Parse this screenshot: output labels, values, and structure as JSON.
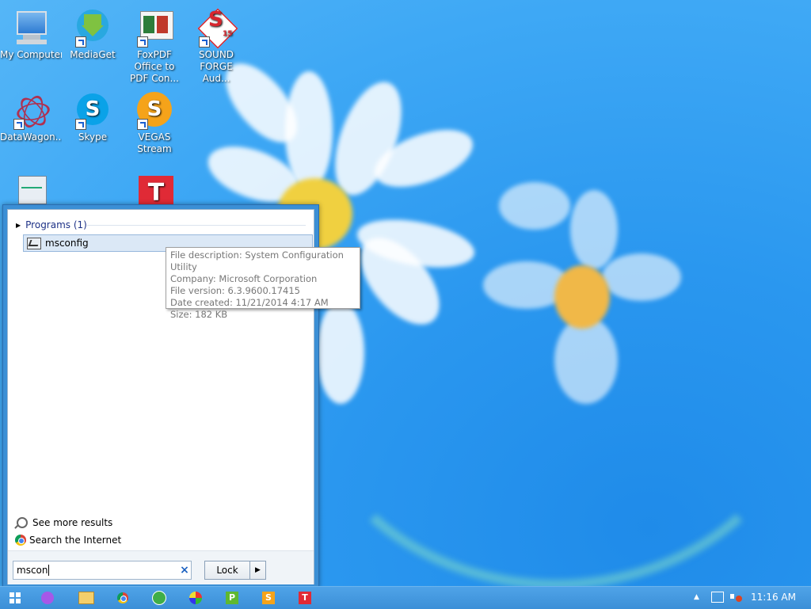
{
  "desktop": {
    "icons": [
      {
        "label": "My Computer"
      },
      {
        "label": "MediaGet"
      },
      {
        "label": "FoxPDF Office to PDF Con..."
      },
      {
        "label": "SOUND FORGE Aud..."
      },
      {
        "label": "DataWagon..."
      },
      {
        "label": "Skype"
      },
      {
        "label": "VEGAS Stream"
      }
    ],
    "sound_forge_badge": "15",
    "skype_glyph": "S",
    "vegas_glyph": "S",
    "red_t_glyph": "T"
  },
  "start_menu": {
    "programs_header": "Programs (1)",
    "result_label": "msconfig",
    "tooltip": {
      "line1": "File description: System Configuration Utility",
      "line2": "Company: Microsoft Corporation",
      "line3": "File version: 6.3.9600.17415",
      "line4": "Date created: 11/21/2014 4:17 AM",
      "line5": "Size: 182 KB"
    },
    "see_more": "See more results",
    "search_internet": "Search the Internet",
    "search_value": "mscon",
    "clear_glyph": "×",
    "lock_label": "Lock",
    "lock_arrow": "▶"
  },
  "taskbar": {
    "apps": [
      {
        "icon": "start-icon"
      },
      {
        "icon": "purple-app-icon"
      },
      {
        "icon": "file-explorer-icon"
      },
      {
        "icon": "chrome-icon"
      },
      {
        "icon": "green-e-icon"
      },
      {
        "icon": "color-wheel-icon"
      },
      {
        "icon": "p-app-icon",
        "glyph": "P"
      },
      {
        "icon": "s-app-icon",
        "glyph": "S"
      },
      {
        "icon": "t-app-icon",
        "glyph": "T"
      }
    ],
    "tray_arrow": "▲",
    "clock": "11:16 AM"
  }
}
